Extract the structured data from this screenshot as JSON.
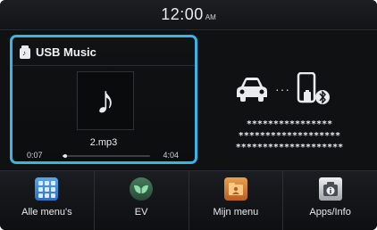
{
  "status_bar": {
    "time": "12:00",
    "ampm": "AM"
  },
  "music_widget": {
    "title": "USB Music",
    "track_name": "2.mp3",
    "elapsed": "0:07",
    "total": "4:04",
    "progress_fraction": 0.03,
    "icon": "usb-music-icon",
    "album_art_icon": "music-note-icon"
  },
  "phone_widget": {
    "car_icon": "car-icon",
    "link_dots": "···",
    "phone_icon": "phone-bluetooth-icon",
    "masked_lines": [
      "****************",
      "*******************",
      "********************"
    ]
  },
  "bottom_menu": {
    "items": [
      {
        "label": "Alle menu's",
        "icon": "all-menus-grid-icon"
      },
      {
        "label": "EV",
        "icon": "ev-leaf-icon"
      },
      {
        "label": "Mijn menu",
        "icon": "my-menu-folder-icon"
      },
      {
        "label": "Apps/Info",
        "icon": "apps-info-icon"
      }
    ]
  },
  "colors": {
    "focus_border": "#39b4e6",
    "background": "#0b0c0e",
    "text": "#e9ecef"
  }
}
